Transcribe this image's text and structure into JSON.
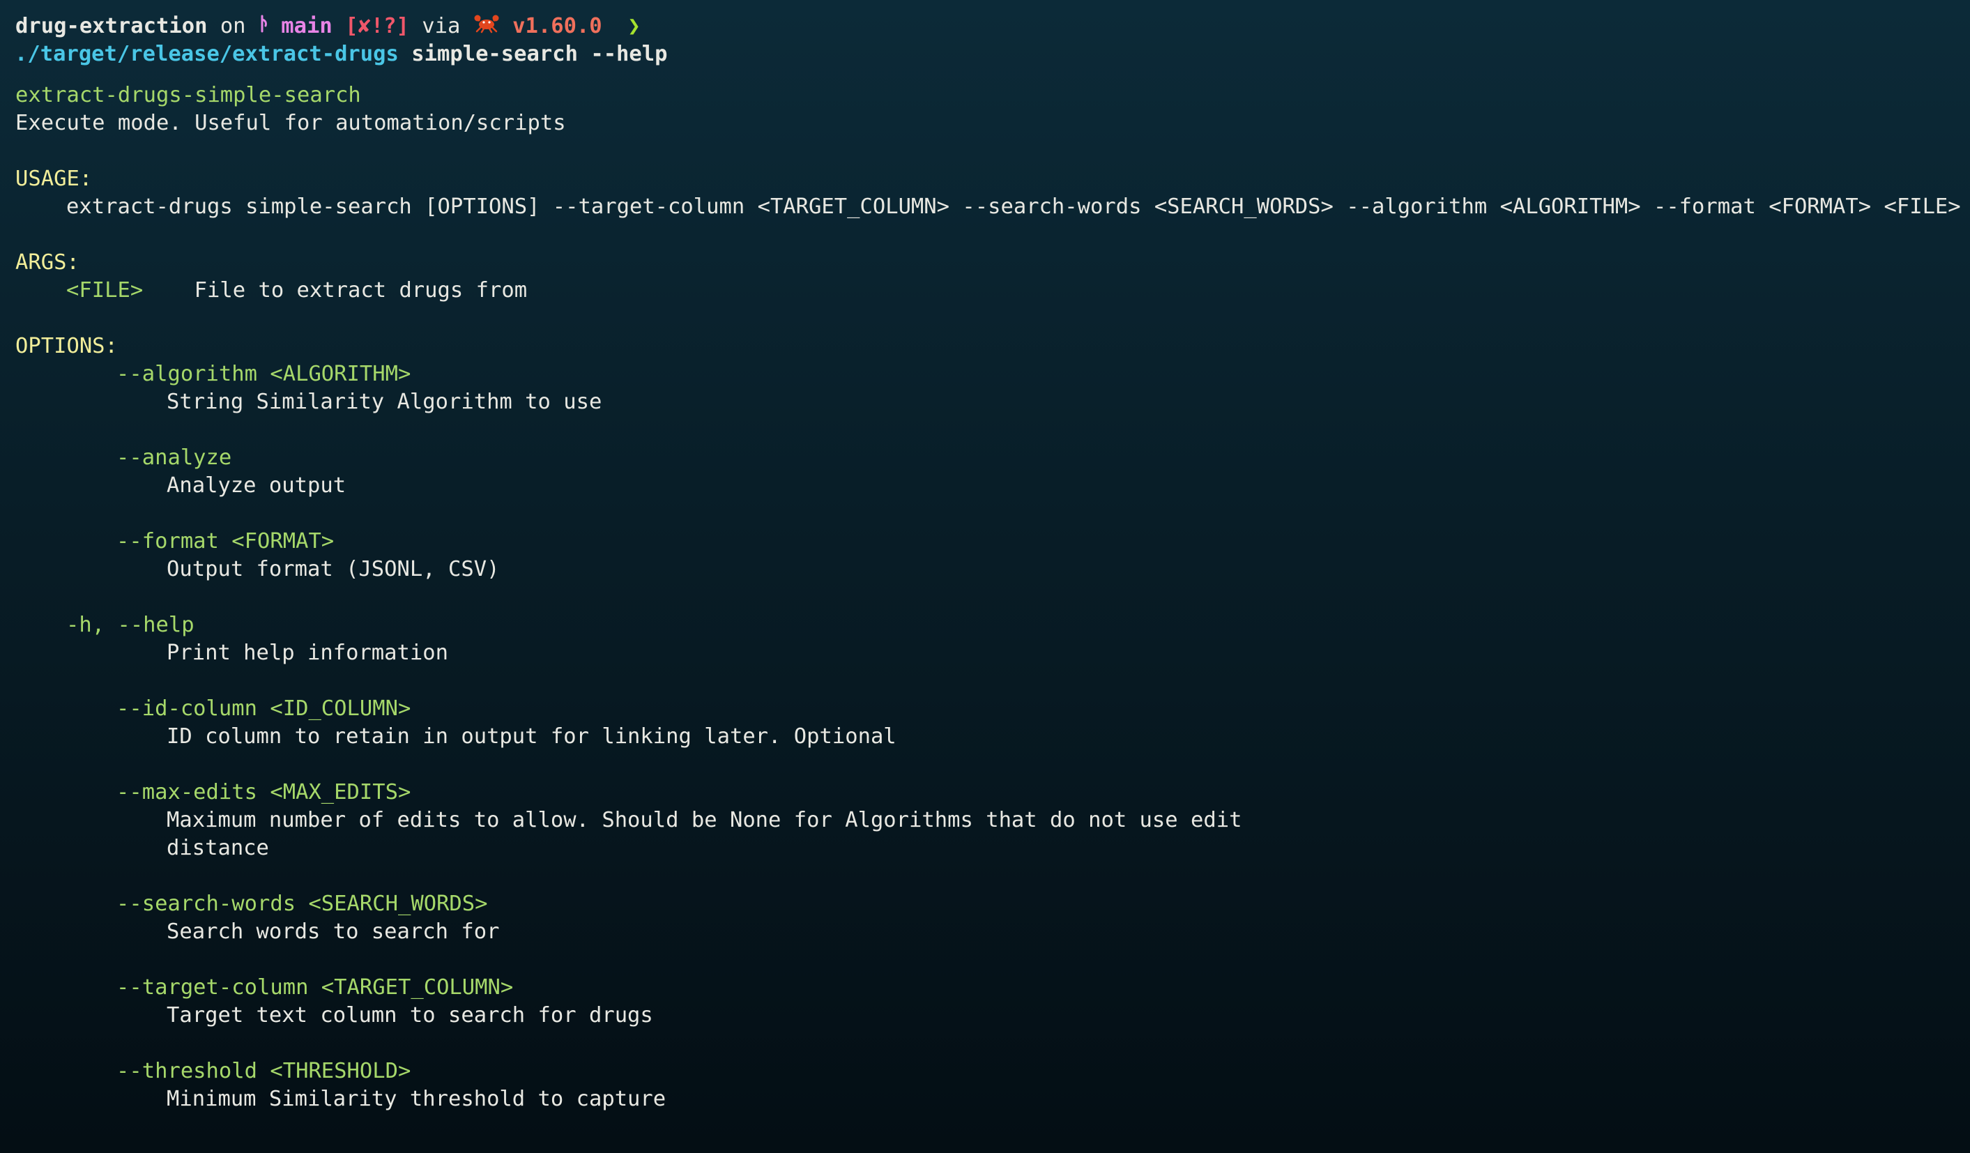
{
  "prompt": {
    "directory": "drug-extraction",
    "on_word": " on ",
    "branch_icon": "git-branch-icon",
    "branch": "main",
    "git_status": " [✘!?]",
    "via_word": " via ",
    "lang_icon": "rust-crab-icon",
    "version": "v1.60.0",
    "prompt_symbol": "❯"
  },
  "command": {
    "path": "./target/release/extract-drugs",
    "args": " simple-search --help"
  },
  "help": {
    "name": "extract-drugs-simple-search",
    "description": "Execute mode. Useful for automation/scripts",
    "usage_heading": "USAGE:",
    "usage_line": "extract-drugs simple-search [OPTIONS] --target-column <TARGET_COLUMN> --search-words <SEARCH_WORDS> --algorithm <ALGORITHM> --format <FORMAT> <FILE>",
    "args_heading": "ARGS:",
    "args": [
      {
        "name": "<FILE>",
        "description": "File to extract drugs from"
      }
    ],
    "options_heading": "OPTIONS:",
    "options": [
      {
        "flag": "--algorithm <ALGORITHM>",
        "description": [
          "String Similarity Algorithm to use"
        ]
      },
      {
        "flag": "--analyze",
        "description": [
          "Analyze output"
        ]
      },
      {
        "flag": "--format <FORMAT>",
        "description": [
          "Output format (JSONL, CSV)"
        ]
      },
      {
        "flag": "-h, --help",
        "description": [
          "Print help information"
        ]
      },
      {
        "flag": "--id-column <ID_COLUMN>",
        "description": [
          "ID column to retain in output for linking later. Optional"
        ]
      },
      {
        "flag": "--max-edits <MAX_EDITS>",
        "description": [
          "Maximum number of edits to allow. Should be None for Algorithms that do not use edit",
          "distance"
        ]
      },
      {
        "flag": "--search-words <SEARCH_WORDS>",
        "description": [
          "Search words to search for"
        ]
      },
      {
        "flag": "--target-column <TARGET_COLUMN>",
        "description": [
          "Target text column to search for drugs"
        ]
      },
      {
        "flag": "--threshold <THRESHOLD>",
        "description": [
          "Minimum Similarity threshold to capture"
        ]
      }
    ]
  },
  "colors": {
    "background_top": "#0c2a38",
    "background_bottom": "#040e14",
    "flag_green": "#a6d86a",
    "heading_yellow": "#f2ee9a",
    "path_cyan": "#4ac6e6",
    "branch_magenta": "#e884e6",
    "status_red": "#f0576a",
    "version_orange": "#f0705c"
  }
}
